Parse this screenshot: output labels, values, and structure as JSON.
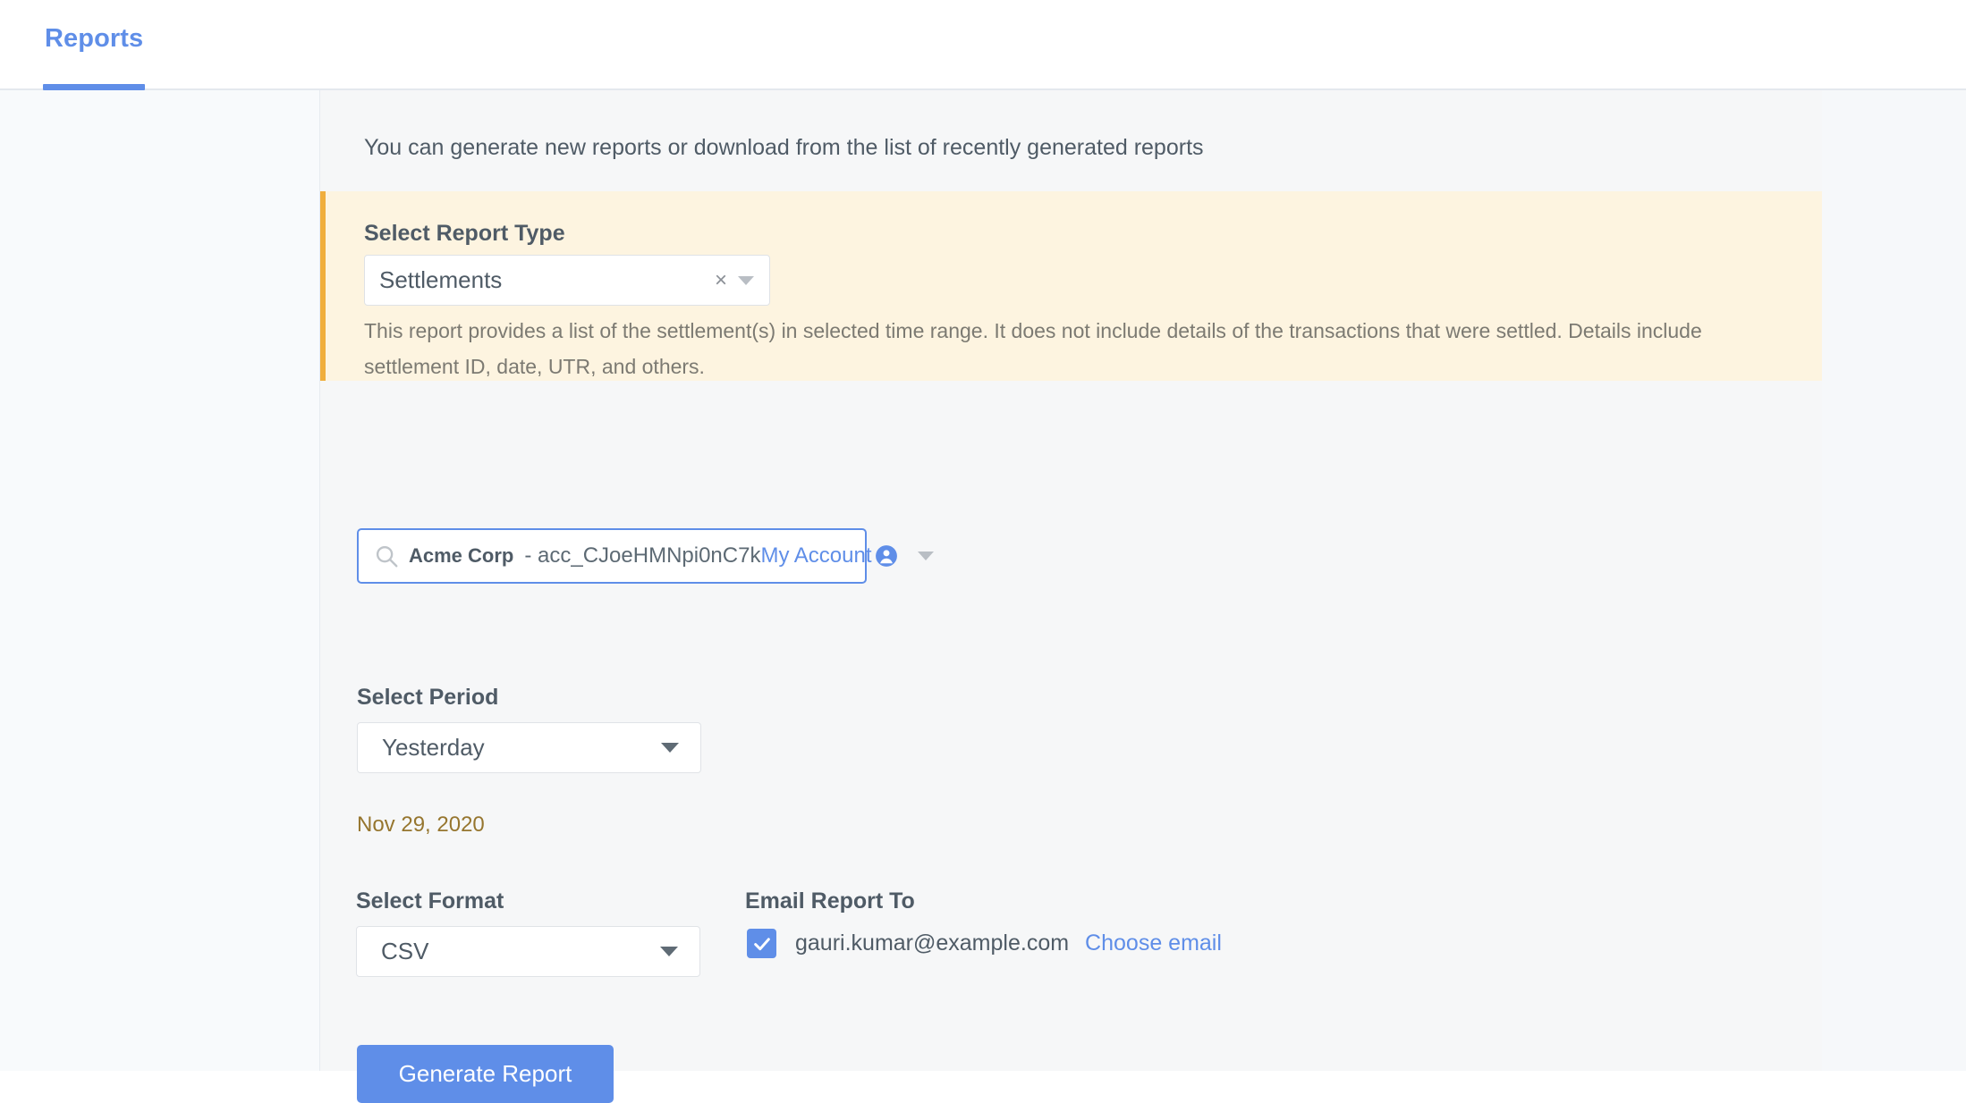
{
  "tabs": [
    {
      "label": "Reports",
      "active": true
    }
  ],
  "main": {
    "intro": "You can generate new reports or download from the list of recently generated reports"
  },
  "report_type": {
    "label": "Select Report Type",
    "value": "Settlements",
    "clear_glyph": "×",
    "description": "This report provides a list of the settlement(s) in selected time range. It does not include details of the transactions that were settled. Details include settlement ID, date, UTR, and others.",
    "accent_color": "#f0ae3c",
    "background_color": "#fdf4e0"
  },
  "account": {
    "name": "Acme Corp",
    "id": "- acc_CJoeHMNpi0nC7k",
    "badge_label": "My Account",
    "icon": "search-icon"
  },
  "period": {
    "label": "Select Period",
    "value": "Yesterday",
    "date_text": "Nov 29, 2020"
  },
  "format": {
    "label": "Select Format",
    "value": "CSV"
  },
  "email": {
    "label": "Email Report To",
    "address": "gauri.kumar@example.com",
    "choose_link": "Choose email",
    "checked": true
  },
  "actions": {
    "generate_label": "Generate Report"
  },
  "colors": {
    "accent_blue": "#5f8ee8",
    "accent_orange": "#f0ae3c",
    "date_text": "#96762f"
  }
}
